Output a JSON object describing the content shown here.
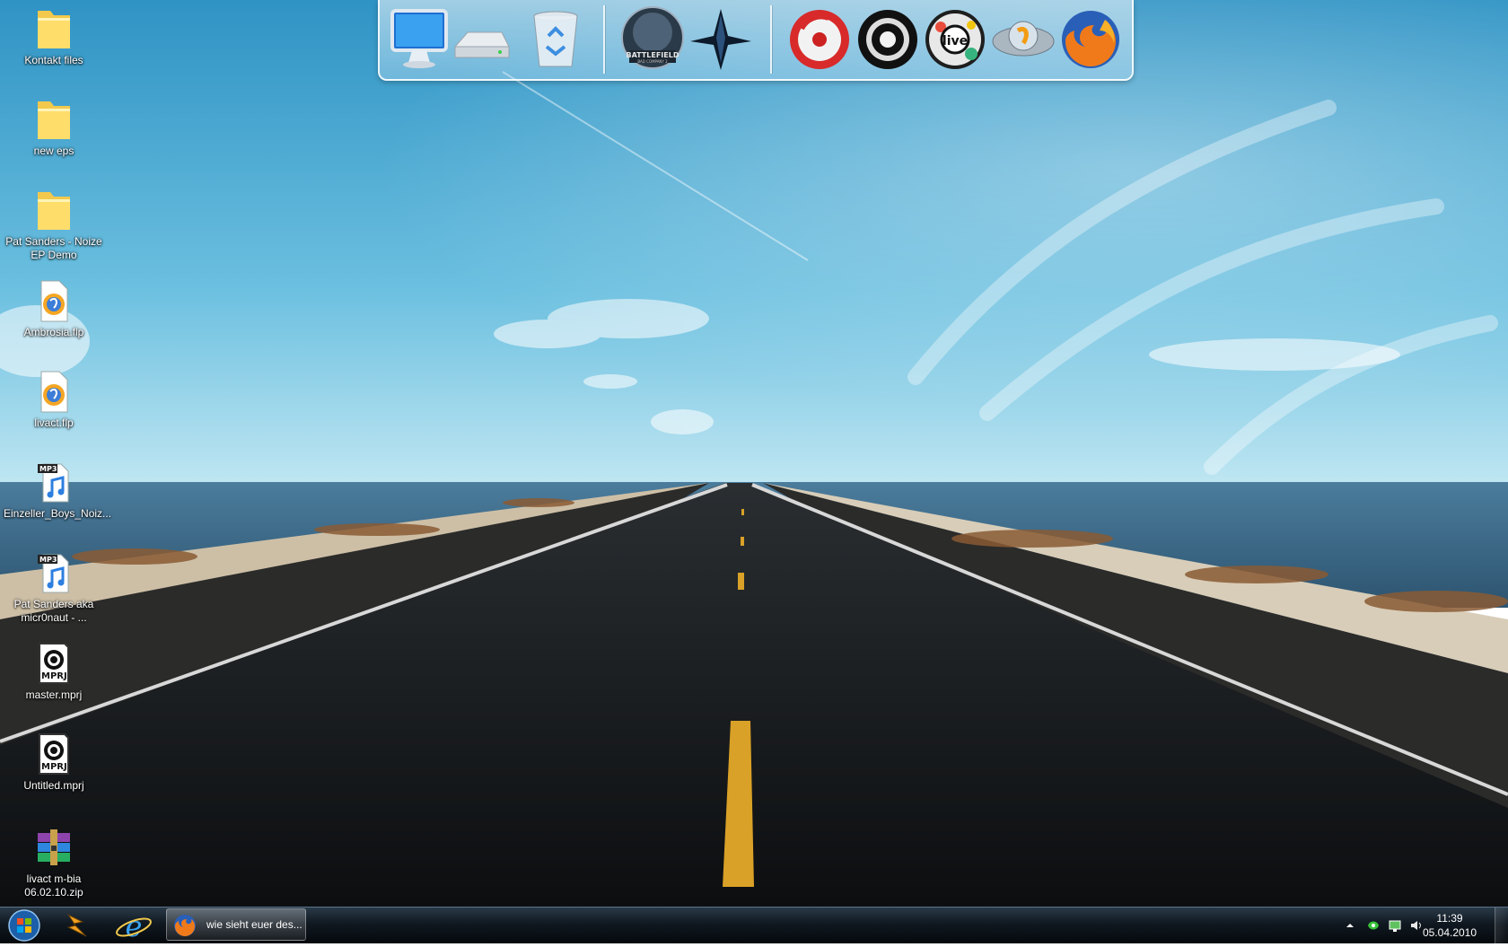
{
  "desktop": {
    "icons": [
      {
        "label": "Kontakt files",
        "icon": "folder-icon"
      },
      {
        "label": "new eps",
        "icon": "folder-icon"
      },
      {
        "label": "Pat Sanders - Noize EP Demo",
        "icon": "folder-icon"
      },
      {
        "label": "Ambrosia.flp",
        "icon": "fl-studio-file-icon"
      },
      {
        "label": "livact.flp",
        "icon": "fl-studio-file-icon"
      },
      {
        "label": "Einzeller_Boys_Noiz...",
        "icon": "mp3-file-icon",
        "badge": "MP3"
      },
      {
        "label": "Pat Sanders aka micr0naut - ...",
        "icon": "mp3-file-icon",
        "badge": "MP3"
      },
      {
        "label": "master.mprj",
        "icon": "mprj-file-icon",
        "badge": "MPRJ"
      },
      {
        "label": "Untitled.mprj",
        "icon": "mprj-file-icon",
        "badge": "MPRJ"
      },
      {
        "label": "livact m-bia 06.02.10.zip",
        "icon": "winrar-archive-icon"
      }
    ]
  },
  "dock": {
    "items": [
      {
        "name": "computer-icon"
      },
      {
        "name": "drive-icon"
      },
      {
        "name": "recycle-bin-icon"
      },
      {
        "name": "battlefield-icon",
        "text": "BATTLEFIELD",
        "subtext": "BAD COMPANY 2"
      },
      {
        "name": "star-app-icon"
      },
      {
        "name": "red-disc-app-icon"
      },
      {
        "name": "black-disc-app-icon"
      },
      {
        "name": "ableton-live-icon",
        "text": "live"
      },
      {
        "name": "fl-studio-icon"
      },
      {
        "name": "firefox-icon"
      }
    ]
  },
  "taskbar": {
    "pinned": [
      {
        "name": "start-orb-icon"
      },
      {
        "name": "winamp-icon"
      },
      {
        "name": "internet-explorer-icon"
      }
    ],
    "active_task": {
      "label": "wie sieht euer des...",
      "icon": "firefox-icon"
    },
    "tray": {
      "icons": [
        "show-hidden-arrow-icon",
        "green-tray-icon",
        "network-tray-icon",
        "volume-icon"
      ]
    },
    "clock": {
      "time": "11:39",
      "date": "05.04.2010"
    }
  },
  "colors": {
    "sky_top": "#3a9cc8",
    "sky_horizon": "#b9e4f2",
    "sea": "#3f6f8f",
    "road": "#111417",
    "lane_yellow": "#d9a127",
    "taskbar": "#0d151c"
  }
}
